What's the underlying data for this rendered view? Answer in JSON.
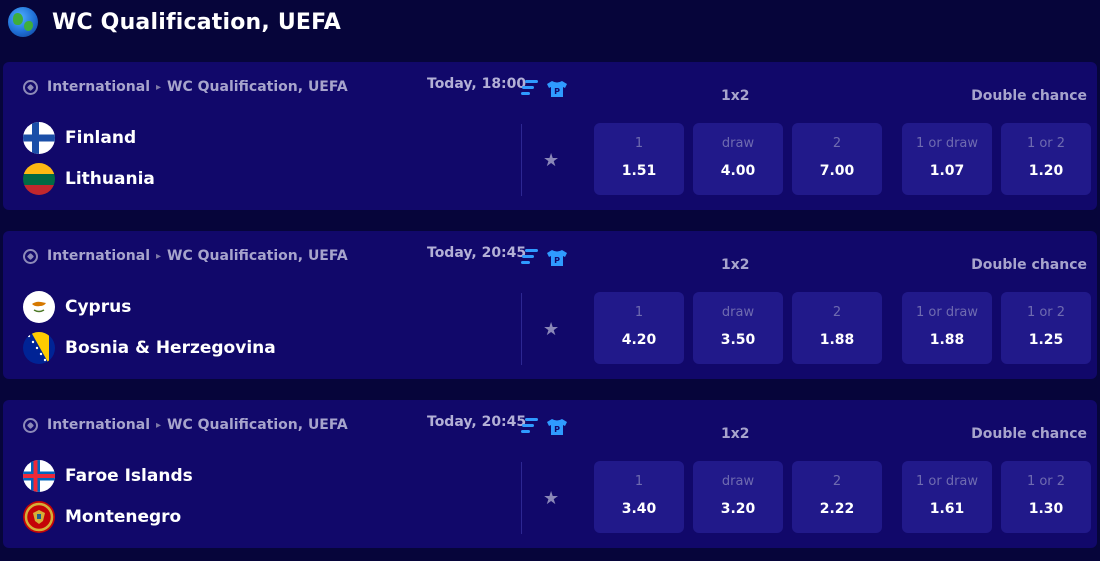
{
  "header": {
    "title": "WC Qualification, UEFA",
    "icon": "globe-icon"
  },
  "markets": {
    "main": "1x2",
    "secondary": "Double chance"
  },
  "odds_labels": [
    "1",
    "draw",
    "2",
    "1 or draw",
    "1 or 2"
  ],
  "colors": {
    "background": "#06053a",
    "card": "#11086a",
    "odds_button": "#21198a",
    "accent_blue": "#2f9bff"
  },
  "matches": [
    {
      "category": "International",
      "competition": "WC Qualification, UEFA",
      "time": "Today, 18:00",
      "home": {
        "name": "Finland",
        "flag": "finland-flag-icon"
      },
      "away": {
        "name": "Lithuania",
        "flag": "lithuania-flag-icon"
      },
      "odds": [
        "1.51",
        "4.00",
        "7.00",
        "1.07",
        "1.20"
      ]
    },
    {
      "category": "International",
      "competition": "WC Qualification, UEFA",
      "time": "Today, 20:45",
      "home": {
        "name": "Cyprus",
        "flag": "cyprus-flag-icon"
      },
      "away": {
        "name": "Bosnia & Herzegovina",
        "flag": "bosnia-flag-icon"
      },
      "odds": [
        "4.20",
        "3.50",
        "1.88",
        "1.88",
        "1.25"
      ]
    },
    {
      "category": "International",
      "competition": "WC Qualification, UEFA",
      "time": "Today, 20:45",
      "home": {
        "name": "Faroe Islands",
        "flag": "faroe-islands-flag-icon"
      },
      "away": {
        "name": "Montenegro",
        "flag": "montenegro-flag-icon"
      },
      "odds": [
        "3.40",
        "3.20",
        "2.22",
        "1.61",
        "1.30"
      ]
    }
  ]
}
